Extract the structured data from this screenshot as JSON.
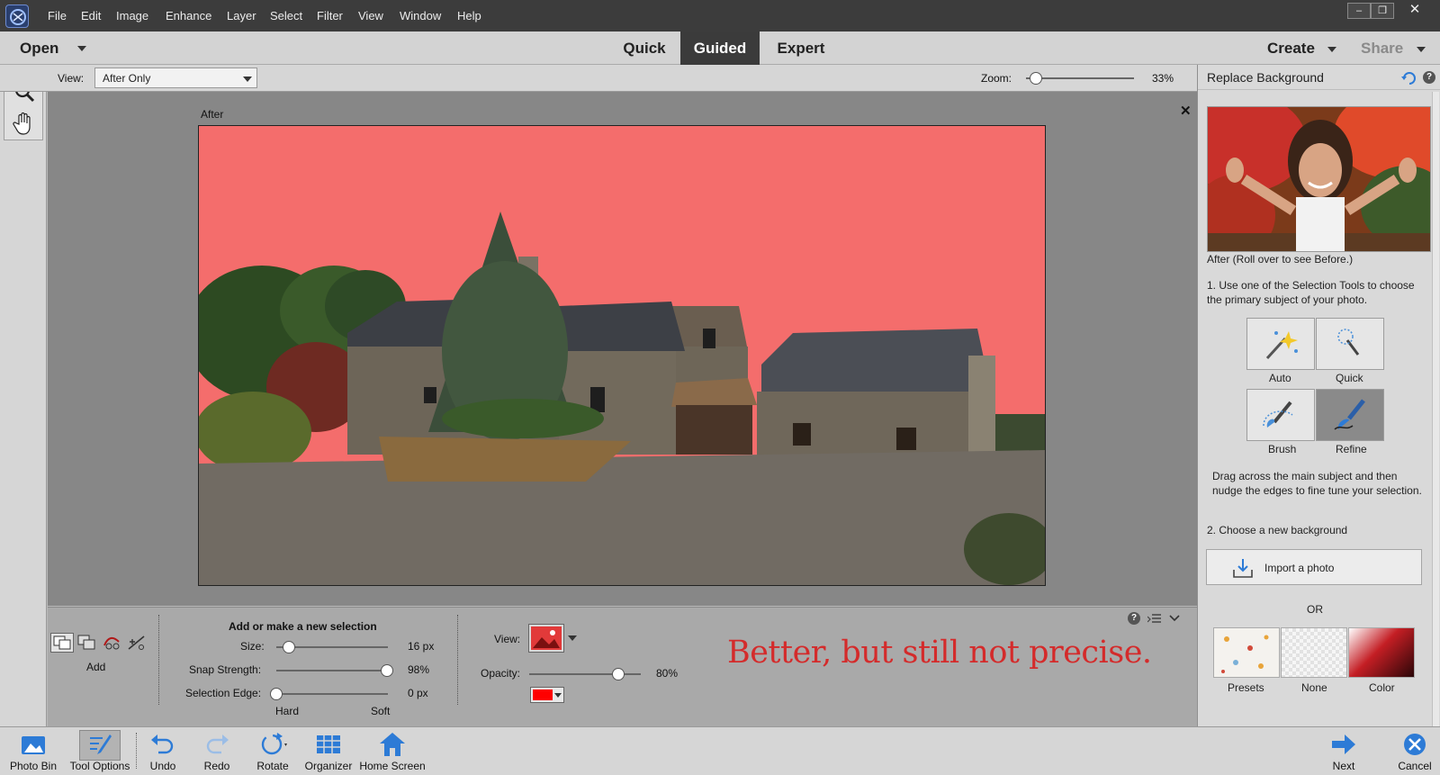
{
  "menu": [
    "File",
    "Edit",
    "Image",
    "Enhance",
    "Layer",
    "Select",
    "Filter",
    "View",
    "Window",
    "Help"
  ],
  "modebar": {
    "open": "Open",
    "tabs": [
      "Quick",
      "Guided",
      "Expert"
    ],
    "active": "Guided",
    "create": "Create",
    "share": "Share"
  },
  "options": {
    "view_label": "View:",
    "view_value": "After Only",
    "zoom_label": "Zoom:",
    "zoom_value": "33%"
  },
  "canvas": {
    "caption": "After"
  },
  "tool_options": {
    "mode_label": "Add",
    "title": "Add or make a new selection",
    "size_label": "Size:",
    "size_value": "16 px",
    "snap_label": "Snap Strength:",
    "snap_value": "98%",
    "edge_label": "Selection Edge:",
    "edge_value": "0 px",
    "hard": "Hard",
    "soft": "Soft",
    "view_label": "View:",
    "opacity_label": "Opacity:",
    "opacity_value": "80%",
    "overlay_color": "#ff0000",
    "annotation": "Better, but still not precise."
  },
  "panel": {
    "title": "Replace Background",
    "after_note": "After (Roll over to see Before.)",
    "step1": "1. Use one of the Selection Tools to choose the primary subject of your photo.",
    "tools": [
      "Auto",
      "Quick",
      "Brush",
      "Refine"
    ],
    "active_tool": "Refine",
    "drag_note": "Drag across the main subject and then nudge the edges to fine tune your selection.",
    "step2": "2. Choose a new background",
    "import": "Import a photo",
    "or": "OR",
    "bg_options": [
      "Presets",
      "None",
      "Color"
    ]
  },
  "bottom": {
    "left": [
      "Photo Bin",
      "Tool Options",
      "Undo",
      "Redo",
      "Rotate",
      "Organizer",
      "Home Screen"
    ],
    "next": "Next",
    "cancel": "Cancel"
  },
  "colors": {
    "selection_overlay": "#f46d6c",
    "active_tab": "#3b3b3b",
    "accent_blue": "#2d7bd6"
  }
}
